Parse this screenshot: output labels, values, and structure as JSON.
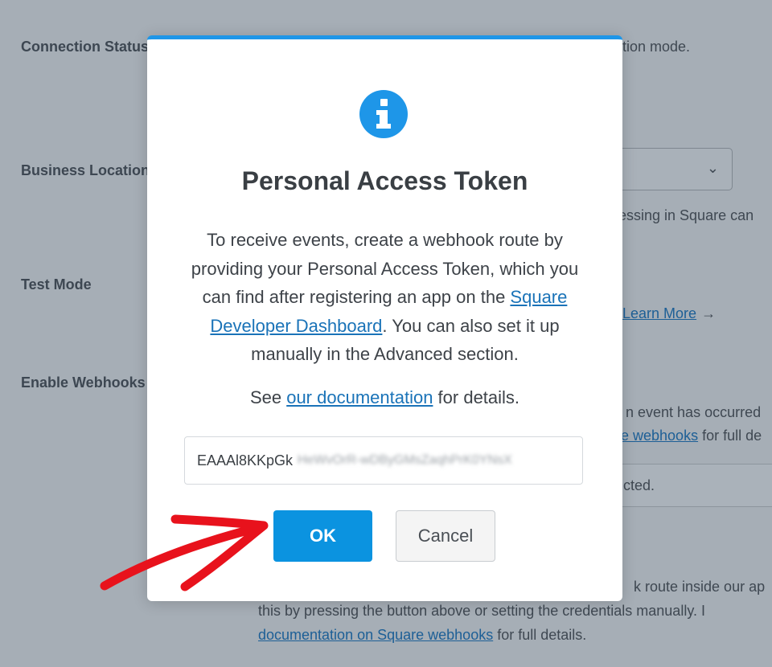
{
  "background": {
    "labels": {
      "connection_status": "Connection Status",
      "business_location": "Business Location",
      "test_mode": "Test Mode",
      "enable_webhooks": "Enable Webhooks"
    },
    "connection_status_text": "tion mode.",
    "business_location_help": "cessing in Square can",
    "test_mode_learn_more": "Learn More",
    "webhooks_help_line1": "n event has occurred",
    "webhooks_help_link": "e webhooks",
    "webhooks_help_line2_tail": " for full de",
    "webhook_input_text": "cted.",
    "footer_line1": "k route inside our ap",
    "footer_line2": "this by pressing the button above or setting the credentials manually. I",
    "footer_link": "documentation on Square webhooks",
    "footer_line3_tail": " for full details."
  },
  "modal": {
    "icon": "info-icon",
    "title": "Personal Access Token",
    "body_before_link": "To receive events, create a webhook route by providing your Personal Access Token, which you can find after registering an app on the ",
    "body_link": "Square Developer Dashboard",
    "body_after_link": ". You can also set it up manually in the Advanced section.",
    "see_prefix": "See ",
    "see_link": "our documentation",
    "see_suffix": " for details.",
    "token_visible": "EAAAl8KKpGk",
    "token_obscured": "HeWvOrR-wDByGMsZaqhPrK0YNsX",
    "ok_label": "OK",
    "cancel_label": "Cancel"
  },
  "colors": {
    "accent": "#0b93e0",
    "overlay": "#a6aeb6",
    "annotation_arrow": "#e8121c"
  }
}
